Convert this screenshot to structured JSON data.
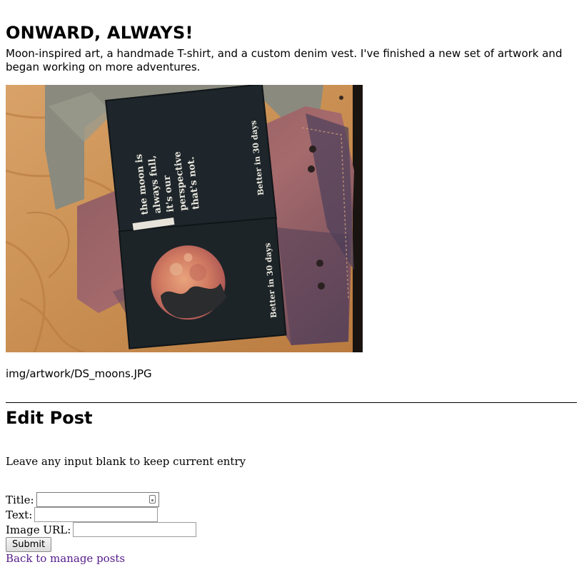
{
  "post": {
    "title": "ONWARD, ALWAYS!",
    "text": "Moon-inspired art, a handmade T-shirt, and a custom denim vest. I've finished a new set of artwork and began working on more adventures.",
    "image_path": "img/artwork/DS_moons.JPG",
    "image": {
      "top_book_lines": [
        "the moon is",
        "always full,",
        "it's our",
        "perspective",
        "that's not."
      ],
      "spine_text": "Better in 30 days"
    }
  },
  "edit_form": {
    "heading": "Edit Post",
    "note": "Leave any input blank to keep current entry",
    "title_label": "Title:",
    "text_label": "Text:",
    "image_url_label": "Image URL:",
    "submit_label": "Submit",
    "back_link": "Back to manage posts"
  },
  "colors": {
    "visited_link": "#551a8b"
  }
}
